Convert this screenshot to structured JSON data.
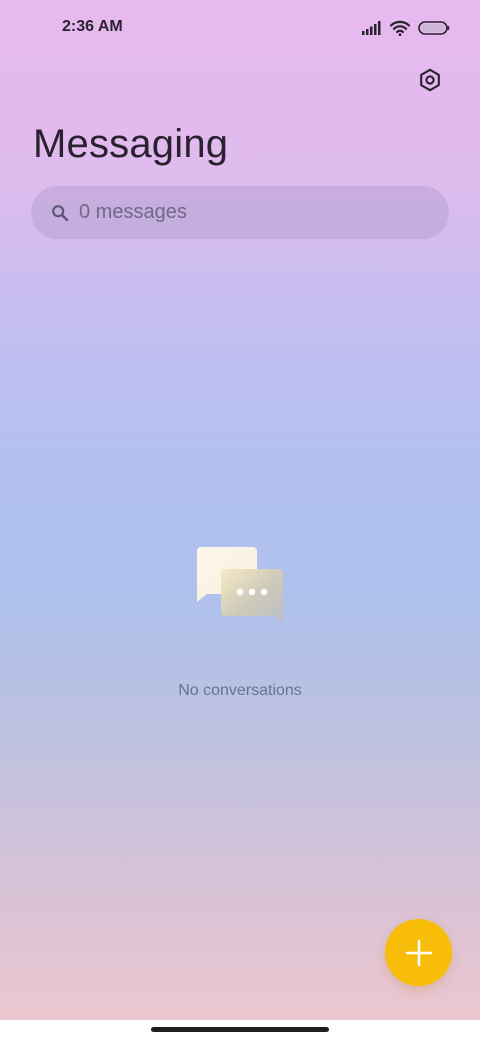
{
  "status_bar": {
    "time": "2:36 AM",
    "icons": [
      "signal-icon",
      "wifi-icon",
      "battery-icon"
    ]
  },
  "header": {
    "title": "Messaging",
    "settings_icon": "settings-icon"
  },
  "search": {
    "placeholder": "0 messages",
    "icon": "search-icon"
  },
  "empty_state": {
    "icon": "chat-bubbles-icon",
    "text": "No conversations"
  },
  "fab": {
    "icon": "plus-icon",
    "color": "#f8bd08"
  },
  "colors": {
    "accent": "#f8bd08",
    "title_text": "#2a2230",
    "muted_text": "#6b7290"
  }
}
